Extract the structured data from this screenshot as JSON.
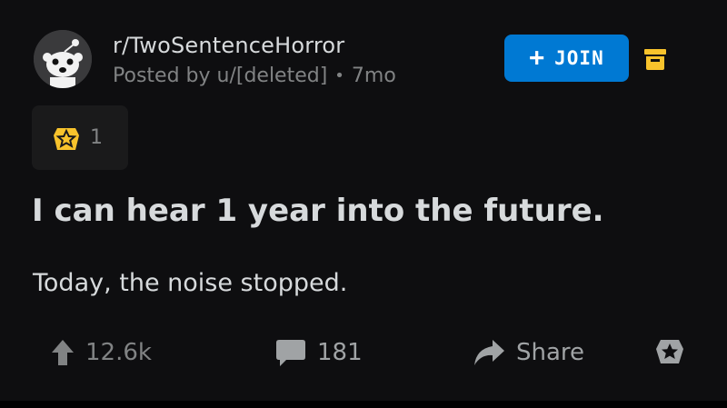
{
  "post": {
    "subreddit": "r/TwoSentenceHorror",
    "posted_by": "Posted by u/[deleted]",
    "age": "7mo",
    "join_label": "JOIN",
    "award_count": "1",
    "title": "I can hear 1 year into the future.",
    "body": "Today, the noise stopped."
  },
  "actions": {
    "upvotes": "12.6k",
    "comments": "181",
    "share": "Share"
  },
  "colors": {
    "background": "#0e0e10",
    "join_button": "#0079d3",
    "archive_icon": "#f8c32c",
    "award_icon": "#f8c32c",
    "muted_text": "#818384"
  },
  "icons": {
    "avatar": "reddit-snoo-avatar",
    "archive": "archive-icon",
    "award": "award-icon",
    "upvote": "upvote-arrow-icon",
    "comment": "comment-bubble-icon",
    "share": "share-arrow-icon",
    "give_award": "give-award-icon"
  }
}
